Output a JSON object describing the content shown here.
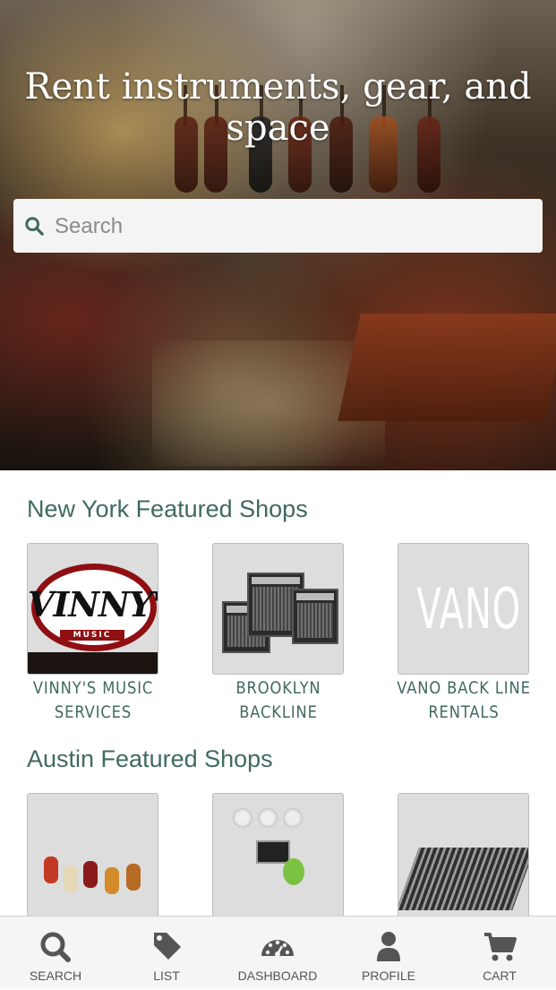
{
  "hero": {
    "title": "Rent instruments, gear, and space",
    "search": {
      "placeholder": "Search",
      "icon": "search-icon"
    }
  },
  "sections": [
    {
      "title": "New York Featured Shops",
      "shops": [
        {
          "name": "VINNY'S MUSIC SERVICES",
          "logo_text": "VINNY'S",
          "logo_sub": "MUSIC"
        },
        {
          "name": "BROOKLYN BACKLINE"
        },
        {
          "name": "VANO BACK LINE RENTALS",
          "logo_text": "VANO"
        }
      ]
    },
    {
      "title": "Austin Featured Shops",
      "shops": [
        {
          "name": ""
        },
        {
          "name": ""
        },
        {
          "name": ""
        }
      ]
    }
  ],
  "bottom_nav": [
    {
      "label": "SEARCH",
      "icon": "search-icon"
    },
    {
      "label": "LIST",
      "icon": "tag-icon"
    },
    {
      "label": "DASHBOARD",
      "icon": "dashboard-gauge-icon"
    },
    {
      "label": "PROFILE",
      "icon": "user-icon"
    },
    {
      "label": "CART",
      "icon": "cart-icon"
    }
  ],
  "colors": {
    "accent": "#3f6a60",
    "nav_icon": "#555555",
    "nav_bg": "#f5f5f5"
  }
}
